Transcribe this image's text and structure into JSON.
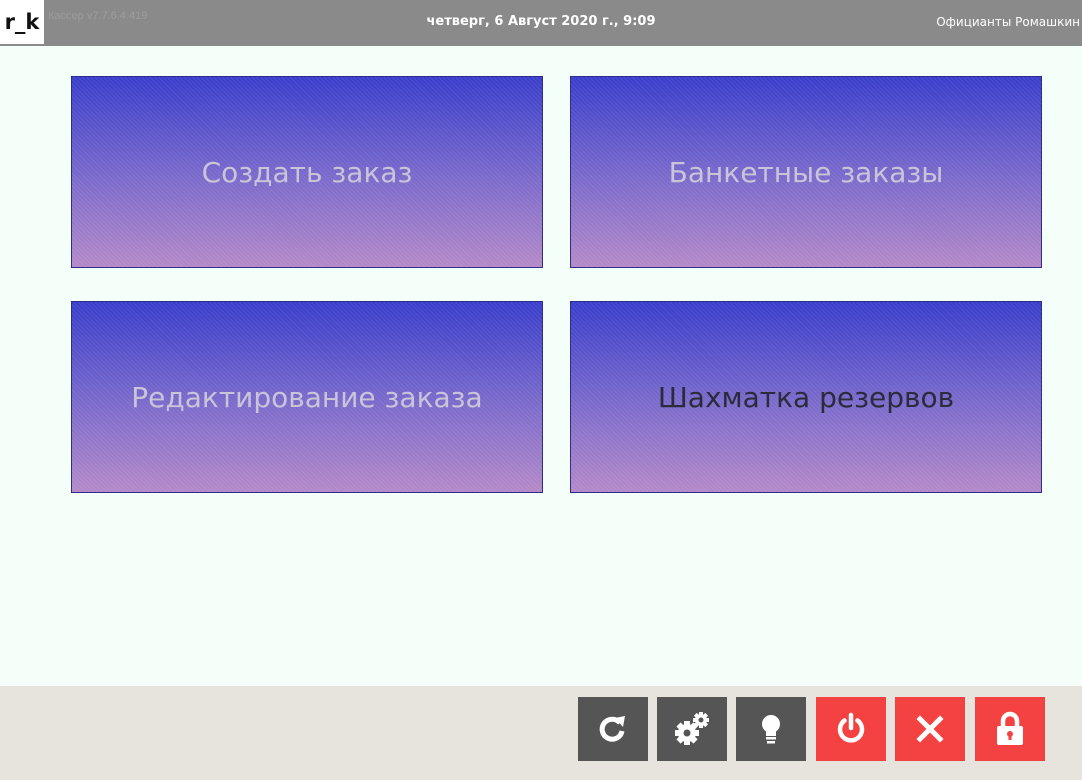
{
  "header": {
    "logo": "r_k",
    "version": "Кассер v7.7.6.4.419",
    "datetime": "четверг, 6 Август 2020 г., 9:09",
    "user": "Официанты Ромашкин"
  },
  "tiles": [
    {
      "label": "Создать заказ"
    },
    {
      "label": "Банкетные заказы"
    },
    {
      "label": "Редактирование заказа"
    },
    {
      "label": "Шахматка резервов"
    }
  ],
  "toolbar": {
    "buttons": [
      {
        "icon": "refresh-icon",
        "color": "#555555"
      },
      {
        "icon": "gears-icon",
        "color": "#555555"
      },
      {
        "icon": "lightbulb-icon",
        "color": "#555555"
      },
      {
        "icon": "power-icon",
        "color": "#f44141"
      },
      {
        "icon": "close-icon",
        "color": "#f44141"
      },
      {
        "icon": "lock-icon",
        "color": "#f44141"
      }
    ]
  },
  "colors": {
    "header_bg": "#8a8a8a",
    "page_bg": "#f4fffa",
    "tile_gradient_top": "#3a3ecb",
    "tile_gradient_bottom": "#b489c8",
    "toolbar_bg": "#e6e4dd"
  }
}
